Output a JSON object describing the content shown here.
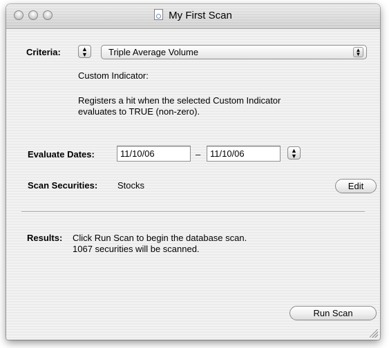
{
  "window": {
    "title": "My First Scan"
  },
  "criteria": {
    "label": "Criteria:",
    "selected": "Triple Average Volume",
    "indicator_label": "Custom Indicator:",
    "description_line1": "Registers a hit when the selected Custom Indicator",
    "description_line2": "evaluates to TRUE (non-zero)."
  },
  "dates": {
    "label": "Evaluate Dates:",
    "start": "11/10/06",
    "separator": "–",
    "end": "11/10/06"
  },
  "securities": {
    "label": "Scan Securities:",
    "value": "Stocks",
    "edit_label": "Edit"
  },
  "results": {
    "label": "Results:",
    "line1": "Click Run Scan to begin the database scan.",
    "line2": "1067 securities will be scanned."
  },
  "actions": {
    "run_label": "Run Scan"
  }
}
